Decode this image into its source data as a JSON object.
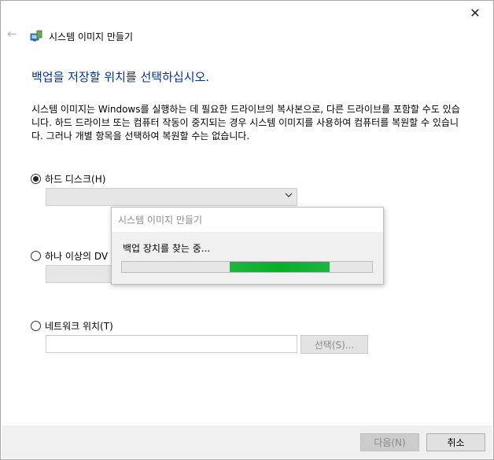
{
  "window": {
    "title": "시스템 이미지 만들기",
    "close_glyph": "✕",
    "back_glyph": "←"
  },
  "heading": "백업을 저장할 위치를 선택하십시오.",
  "description": "시스템 이미지는 Windows를 실행하는 데 필요한 드라이브의 복사본으로, 다른 드라이브를 포함할 수도 있습니다. 하드 드라이브 또는 컴퓨터 작동이 중지되는 경우 시스템 이미지를 사용하여 컴퓨터를 복원할 수 있습니다. 그러나 개별 항목을 선택하여 복원할 수는 없습니다.",
  "options": {
    "hard_disk": {
      "label": "하드 디스크(H)",
      "selected": true
    },
    "dvd": {
      "label": "하나 이상의 DV",
      "selected": false
    },
    "network": {
      "label": "네트워크 위치(T)",
      "selected": false
    }
  },
  "network_path": {
    "value": ""
  },
  "browse_label": "선택(S)...",
  "footer": {
    "next_label": "다음(N)",
    "cancel_label": "취소"
  },
  "progress_dialog": {
    "title": "시스템 이미지 만들기",
    "message": "백업 장치를 찾는 중...",
    "indeterminate": true
  },
  "colors": {
    "heading": "#003399",
    "progress": "#06b025"
  }
}
